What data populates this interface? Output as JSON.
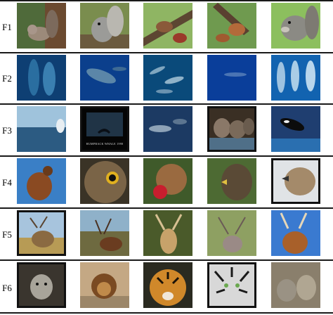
{
  "rows": [
    {
      "label": "F1",
      "subject": "squirrels"
    },
    {
      "label": "F2",
      "subject": "whales and dolphins underwater"
    },
    {
      "label": "F3",
      "subject": "whales, elephants and orca"
    },
    {
      "label": "F4",
      "subject": "hawks, owl and squirrel"
    },
    {
      "label": "F5",
      "subject": "deer with antlers"
    },
    {
      "label": "F6",
      "subject": "wolves, lion and tigers"
    }
  ],
  "poster_caption": "HUMPBACK WHALE 1998"
}
